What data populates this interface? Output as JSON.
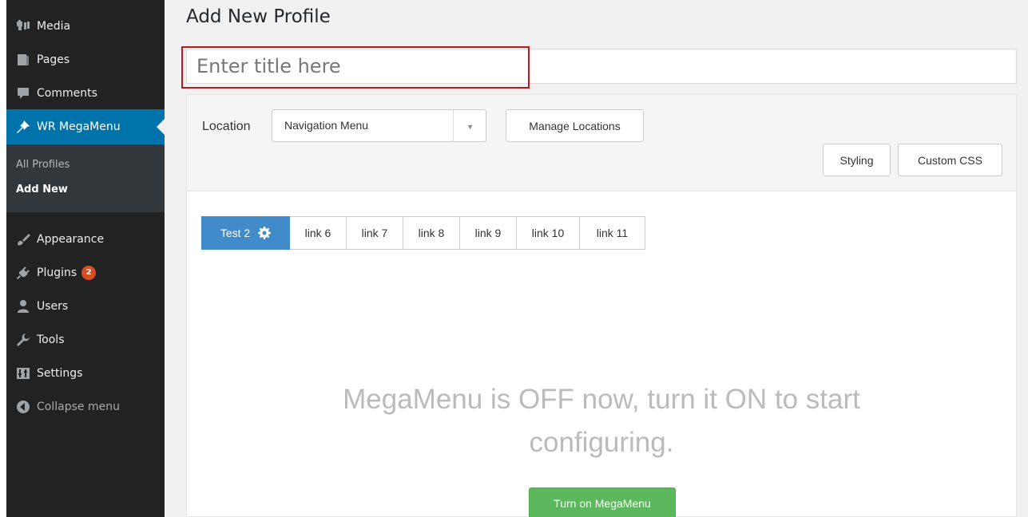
{
  "sidebar": {
    "items": [
      {
        "label": "Media",
        "icon": "media-icon"
      },
      {
        "label": "Pages",
        "icon": "pages-icon"
      },
      {
        "label": "Comments",
        "icon": "comments-icon"
      },
      {
        "label": "WR MegaMenu",
        "icon": "pin-icon"
      },
      {
        "label": "Appearance",
        "icon": "brush-icon"
      },
      {
        "label": "Plugins",
        "icon": "plug-icon",
        "badge": "2"
      },
      {
        "label": "Users",
        "icon": "user-icon"
      },
      {
        "label": "Tools",
        "icon": "wrench-icon"
      },
      {
        "label": "Settings",
        "icon": "settings-icon"
      },
      {
        "label": "Collapse menu",
        "icon": "collapse-arrow-icon"
      }
    ],
    "submenu": [
      {
        "label": "All Profiles"
      },
      {
        "label": "Add New"
      }
    ]
  },
  "page": {
    "title": "Add New Profile",
    "title_placeholder": "Enter title here"
  },
  "toolbar": {
    "location_label": "Location",
    "location_value": "Navigation Menu",
    "manage_locations": "Manage Locations",
    "styling": "Styling",
    "custom_css": "Custom CSS"
  },
  "tabs": [
    "Test 2",
    "link 6",
    "link 7",
    "link 8",
    "link 9",
    "link 10",
    "link 11"
  ],
  "message": {
    "line1": "MegaMenu is OFF now, turn it ON to start",
    "line2": "configuring.",
    "button": "Turn on MegaMenu"
  },
  "colors": {
    "sidebar_bg": "#222222",
    "active_bg": "#0073aa",
    "tab_active": "#428bca",
    "turn_on_btn": "#5cb85c",
    "badge": "#d54e21",
    "highlight": "#b71c1c"
  }
}
